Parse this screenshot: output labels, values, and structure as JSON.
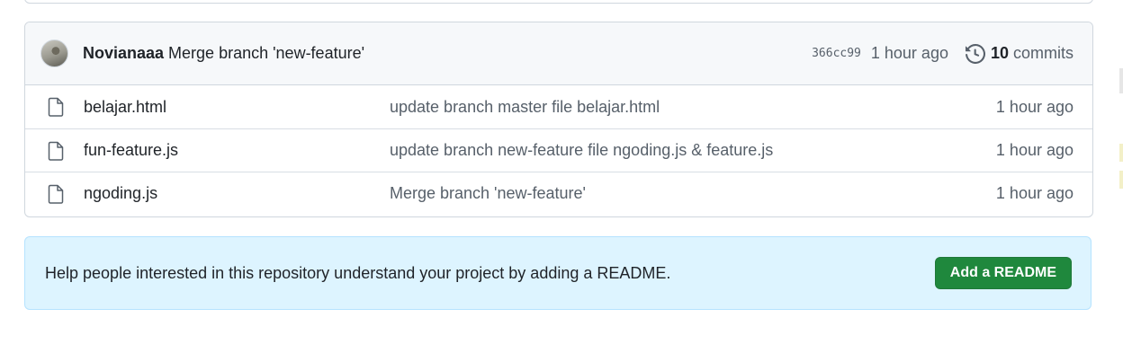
{
  "last_commit": {
    "author": "Novianaaa",
    "message": "Merge branch 'new-feature'",
    "sha": "366cc99",
    "time": "1 hour ago",
    "commit_count": "10",
    "commits_label": "commits"
  },
  "files": [
    {
      "name": "belajar.html",
      "message": "update branch master file belajar.html",
      "time": "1 hour ago"
    },
    {
      "name": "fun-feature.js",
      "message": "update branch new-feature file ngoding.js & feature.js",
      "time": "1 hour ago"
    },
    {
      "name": "ngoding.js",
      "message": "Merge branch 'new-feature'",
      "time": "1 hour ago"
    }
  ],
  "readme_banner": {
    "text": "Help people interested in this repository understand your project by adding a README.",
    "button_label": "Add a README"
  },
  "colors": {
    "accent_button": "#1f883d",
    "banner_bg": "#ddf4ff",
    "header_bg": "#f6f8fa"
  }
}
